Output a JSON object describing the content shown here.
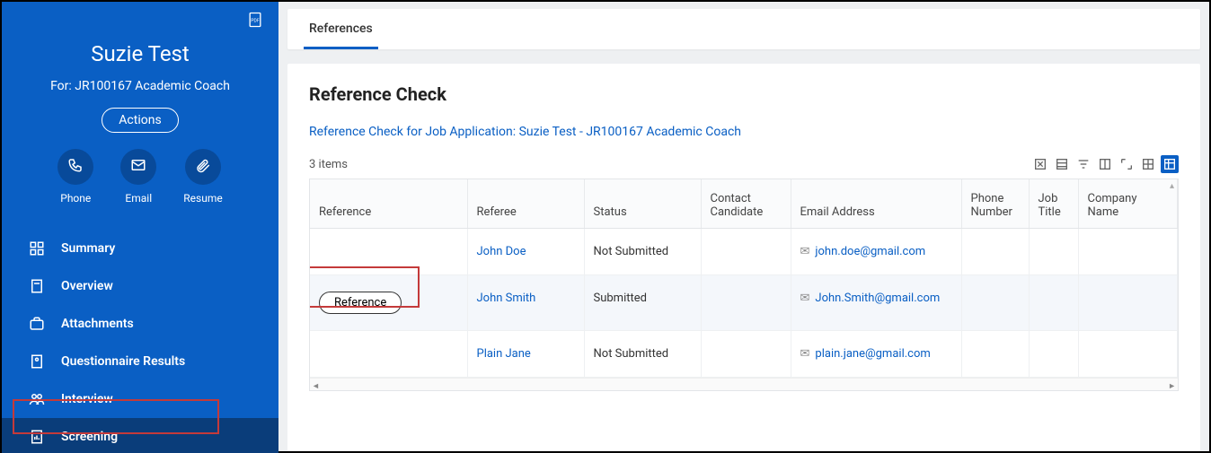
{
  "sidebar": {
    "candidate_name": "Suzie Test",
    "for_line": "For: JR100167 Academic Coach",
    "actions_label": "Actions",
    "contacts": [
      {
        "label": "Phone",
        "icon": "phone-icon"
      },
      {
        "label": "Email",
        "icon": "email-icon"
      },
      {
        "label": "Resume",
        "icon": "attach-icon"
      }
    ],
    "nav": [
      {
        "label": "Summary"
      },
      {
        "label": "Overview"
      },
      {
        "label": "Attachments"
      },
      {
        "label": "Questionnaire Results"
      },
      {
        "label": "Interview"
      },
      {
        "label": "Screening",
        "active": true
      }
    ]
  },
  "main": {
    "tab_label": "References",
    "panel_title": "Reference Check",
    "panel_link": "Reference Check for Job Application: Suzie Test - JR100167 Academic Coach",
    "items_count": "3 items",
    "columns": {
      "reference": "Reference",
      "referee": "Referee",
      "status": "Status",
      "contact_candidate": "Contact Candidate",
      "email": "Email Address",
      "phone": "Phone Number",
      "job_title": "Job Title",
      "company": "Company Name"
    },
    "rows": [
      {
        "reference_btn": "",
        "referee": "John Doe",
        "status": "Not Submitted",
        "email": "john.doe@gmail.com"
      },
      {
        "reference_btn": "Reference",
        "referee": "John Smith",
        "status": "Submitted",
        "email": "John.Smith@gmail.com"
      },
      {
        "reference_btn": "",
        "referee": "Plain Jane",
        "status": "Not Submitted",
        "email": "plain.jane@gmail.com"
      }
    ]
  }
}
